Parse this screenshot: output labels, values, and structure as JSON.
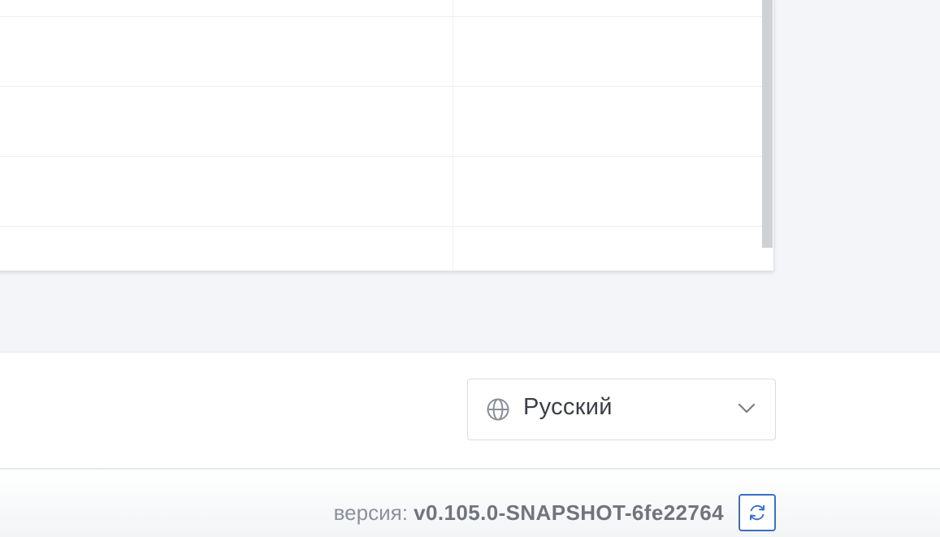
{
  "language_select": {
    "selected": "Русский",
    "icon": "globe-icon",
    "chevron": "chevron-down-icon"
  },
  "version": {
    "label": "версия:",
    "value": "v0.105.0-SNAPSHOT-6fe22764",
    "refresh_icon": "refresh-icon"
  },
  "colors": {
    "background": "#f4f5f9",
    "accent": "#3a6fc6",
    "scrollbar": "#ced2d6"
  }
}
